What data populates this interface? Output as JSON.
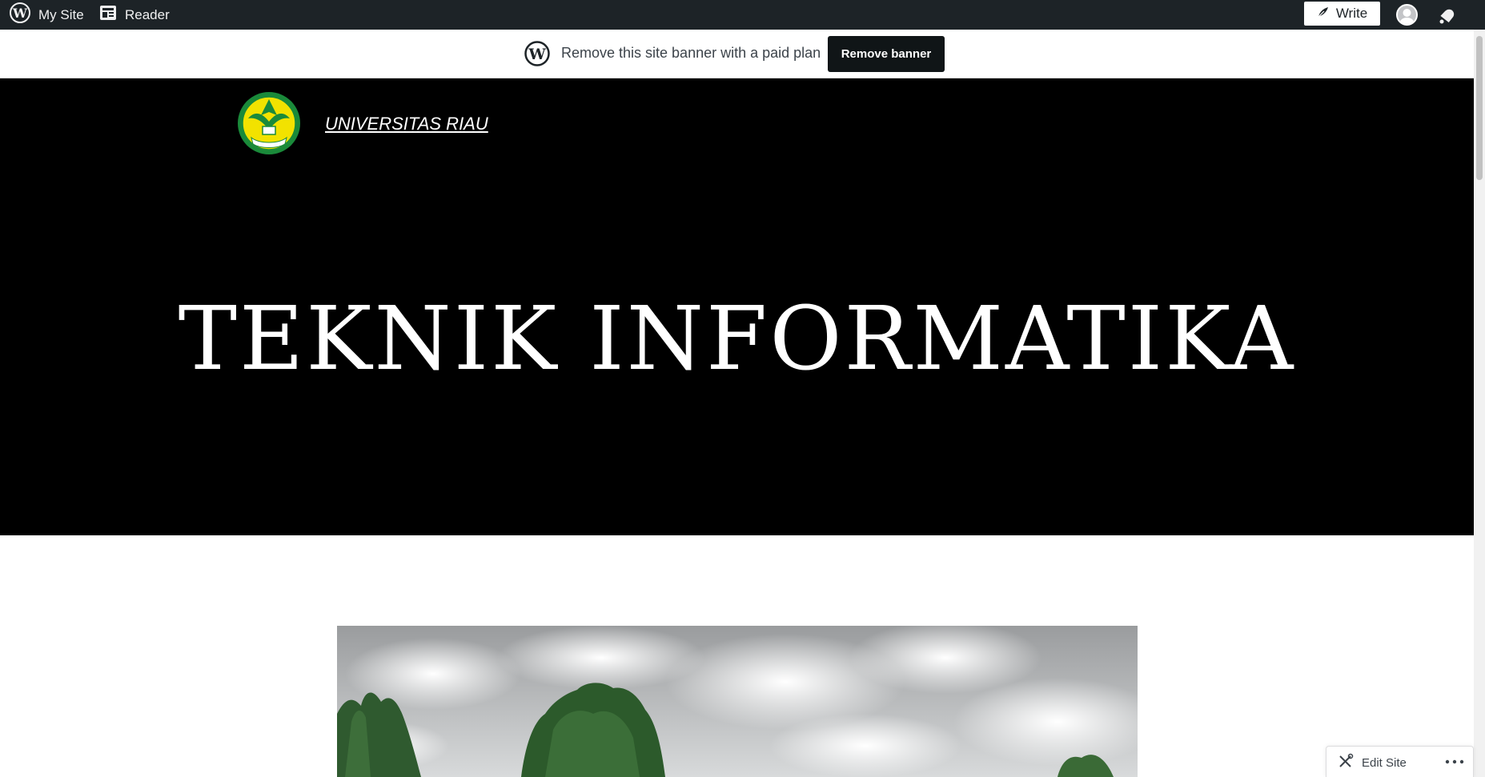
{
  "adminbar": {
    "mysite_label": "My Site",
    "reader_label": "Reader",
    "write_label": "Write",
    "icons": [
      "wordpress-icon",
      "reader-icon",
      "pen-icon",
      "avatar",
      "bell-icon"
    ]
  },
  "banner": {
    "text": "Remove this site banner with a paid plan",
    "button_label": "Remove banner"
  },
  "header": {
    "site_name": "UNIVERSITAS RIAU",
    "title": "TEKNIK INFORMATIKA"
  },
  "floating": {
    "edit_site_label": "Edit Site"
  },
  "colors": {
    "adminbar_bg": "#1d2327",
    "hero_bg": "#000000",
    "button_dark": "#101517",
    "logo_green": "#1a8a3a",
    "logo_yellow": "#f2e200"
  }
}
